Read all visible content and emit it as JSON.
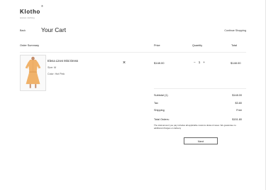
{
  "brand": {
    "name": "Klotho",
    "mark": "®",
    "tagline": "women clothing"
  },
  "nav": {
    "back_label": "Back",
    "continue_label": "Continue Shopping"
  },
  "page": {
    "title": "Your Cart"
  },
  "table": {
    "headers": {
      "summary": "Order Summary",
      "price": "Price",
      "quantity": "Quantity",
      "total": "Total"
    }
  },
  "item": {
    "name": "Elena Linen Mini Dress",
    "size": "Size: M",
    "color": "Color: Hot Pink",
    "remove_icon": "×",
    "price": "$148.00",
    "minus": "−",
    "quantity": "1",
    "plus": "+",
    "total": "$148.00",
    "image_color": "#f0b26a"
  },
  "summary": {
    "subtotal_label": "Subtotal (1)",
    "subtotal_value": "$148.00",
    "tax_label": "Tax",
    "tax_value": "$3.80",
    "shipping_label": "Shipping",
    "shipping_value": "Free",
    "total_label": "Total Orders:",
    "total_value": "$151.80",
    "note": "The total amount you pay includes all applicable customs duties & taxes. We guarantee no additional charges on delivery"
  },
  "actions": {
    "next_label": "Next"
  }
}
